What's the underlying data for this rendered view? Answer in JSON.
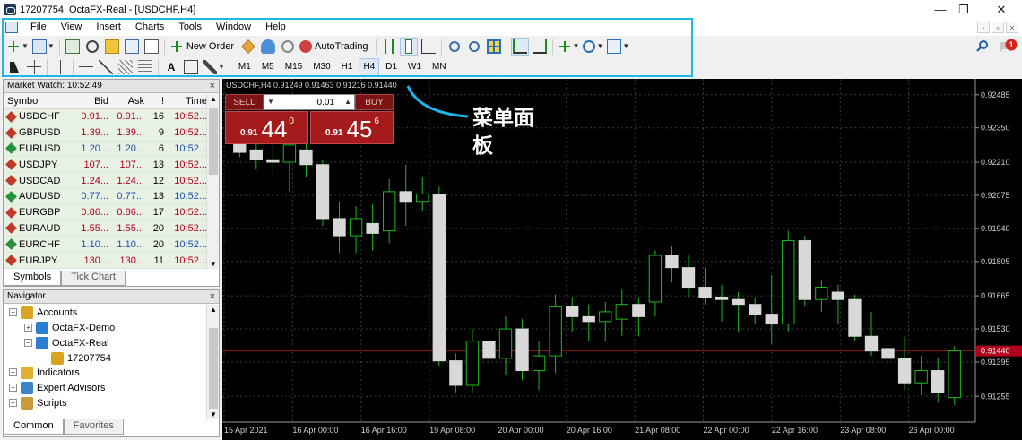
{
  "window": {
    "title": "17207754: OctaFX-Real - [USDCHF,H4]",
    "minimize_glyph": "—",
    "restore_glyph": "❐",
    "close_glyph": "✕"
  },
  "menu": {
    "items": [
      "File",
      "View",
      "Insert",
      "Charts",
      "Tools",
      "Window",
      "Help"
    ],
    "mdi_controls": [
      "-",
      "▫",
      "×"
    ]
  },
  "toolbar1": {
    "new_order_label": "New Order",
    "autotrading_label": "AutoTrading"
  },
  "toolbar2": {
    "text_tool_label": "A",
    "timeframes": [
      "M1",
      "M5",
      "M15",
      "M30",
      "H1",
      "H4",
      "D1",
      "W1",
      "MN"
    ],
    "active_timeframe": "H4"
  },
  "market_watch": {
    "title": "Market Watch: 10:52:49",
    "columns": [
      "Symbol",
      "Bid",
      "Ask",
      "!",
      "Time"
    ],
    "rows": [
      {
        "symbol": "USDCHF",
        "bid": "0.91...",
        "ask": "0.91...",
        "spread": "16",
        "time": "10:52...",
        "dir": "down"
      },
      {
        "symbol": "GBPUSD",
        "bid": "1.39...",
        "ask": "1.39...",
        "spread": "9",
        "time": "10:52...",
        "dir": "down"
      },
      {
        "symbol": "EURUSD",
        "bid": "1.20...",
        "ask": "1.20...",
        "spread": "6",
        "time": "10:52...",
        "dir": "up"
      },
      {
        "symbol": "USDJPY",
        "bid": "107...",
        "ask": "107...",
        "spread": "13",
        "time": "10:52...",
        "dir": "down"
      },
      {
        "symbol": "USDCAD",
        "bid": "1.24...",
        "ask": "1.24...",
        "spread": "12",
        "time": "10:52...",
        "dir": "down"
      },
      {
        "symbol": "AUDUSD",
        "bid": "0.77...",
        "ask": "0.77...",
        "spread": "13",
        "time": "10:52...",
        "dir": "up"
      },
      {
        "symbol": "EURGBP",
        "bid": "0.86...",
        "ask": "0.86...",
        "spread": "17",
        "time": "10:52...",
        "dir": "down"
      },
      {
        "symbol": "EURAUD",
        "bid": "1.55...",
        "ask": "1.55...",
        "spread": "20",
        "time": "10:52...",
        "dir": "down"
      },
      {
        "symbol": "EURCHF",
        "bid": "1.10...",
        "ask": "1.10...",
        "spread": "20",
        "time": "10:52...",
        "dir": "up"
      },
      {
        "symbol": "EURJPY",
        "bid": "130...",
        "ask": "130...",
        "spread": "11",
        "time": "10:52...",
        "dir": "down"
      }
    ],
    "tabs": [
      "Symbols",
      "Tick Chart"
    ],
    "active_tab": "Symbols"
  },
  "navigator": {
    "title": "Navigator",
    "items": [
      {
        "label": "Accounts",
        "level": 0,
        "toggle": "−",
        "icon": "accounts-icon"
      },
      {
        "label": "OctaFX-Demo",
        "level": 1,
        "toggle": "+",
        "icon": "server-icon"
      },
      {
        "label": "OctaFX-Real",
        "level": 1,
        "toggle": "−",
        "icon": "server-icon"
      },
      {
        "label": "17207754",
        "level": 2,
        "toggle": "",
        "icon": "account-user-icon"
      },
      {
        "label": "Indicators",
        "level": 0,
        "toggle": "+",
        "icon": "indicators-icon"
      },
      {
        "label": "Expert Advisors",
        "level": 0,
        "toggle": "+",
        "icon": "expert-advisors-icon"
      },
      {
        "label": "Scripts",
        "level": 0,
        "toggle": "+",
        "icon": "scripts-icon"
      }
    ],
    "tabs": [
      "Common",
      "Favorites"
    ],
    "active_tab": "Common"
  },
  "one_click": {
    "sell_label": "SELL",
    "buy_label": "BUY",
    "lot": "0.01",
    "sell_price_prefix": "0.91",
    "sell_price_big": "44",
    "sell_price_sup": "0",
    "buy_price_prefix": "0.91",
    "buy_price_big": "45",
    "buy_price_sup": "6"
  },
  "annotation": {
    "text": "菜单面板"
  },
  "chart_data": {
    "type": "candlestick",
    "caption": "USDCHF,H4  0.91249 0.91463 0.91216 0.91440",
    "ylim": [
      0.9115,
      0.9255
    ],
    "y_ticks": [
      0.92485,
      0.9235,
      0.9221,
      0.92075,
      0.9194,
      0.91805,
      0.91665,
      0.9153,
      0.91395,
      0.91255
    ],
    "y_tick_labels": [
      "0.92485",
      "0.92350",
      "0.92210",
      "0.92075",
      "0.91940",
      "0.91805",
      "0.91665",
      "0.91530",
      "0.91395",
      "0.91255"
    ],
    "current_price": 0.9144,
    "current_price_label": "0.91440",
    "x_labels": [
      "15 Apr 2021",
      "16 Apr 00:00",
      "16 Apr 16:00",
      "19 Apr 08:00",
      "20 Apr 00:00",
      "20 Apr 16:00",
      "21 Apr 08:00",
      "22 Apr 00:00",
      "22 Apr 16:00",
      "23 Apr 08:00",
      "26 Apr 00:00"
    ],
    "candles": [
      {
        "o": 0.9232,
        "h": 0.9242,
        "l": 0.9223,
        "c": 0.9225
      },
      {
        "o": 0.9226,
        "h": 0.9236,
        "l": 0.9218,
        "c": 0.9222
      },
      {
        "o": 0.9222,
        "h": 0.9233,
        "l": 0.9216,
        "c": 0.9221
      },
      {
        "o": 0.9221,
        "h": 0.923,
        "l": 0.9209,
        "c": 0.9228
      },
      {
        "o": 0.9226,
        "h": 0.9235,
        "l": 0.9215,
        "c": 0.922
      },
      {
        "o": 0.922,
        "h": 0.9222,
        "l": 0.9195,
        "c": 0.9198
      },
      {
        "o": 0.9198,
        "h": 0.9205,
        "l": 0.9184,
        "c": 0.9191
      },
      {
        "o": 0.9191,
        "h": 0.9203,
        "l": 0.9184,
        "c": 0.9198
      },
      {
        "o": 0.9196,
        "h": 0.9204,
        "l": 0.9185,
        "c": 0.9192
      },
      {
        "o": 0.9193,
        "h": 0.9214,
        "l": 0.9188,
        "c": 0.9209
      },
      {
        "o": 0.9209,
        "h": 0.922,
        "l": 0.9195,
        "c": 0.9205
      },
      {
        "o": 0.9205,
        "h": 0.9215,
        "l": 0.9201,
        "c": 0.9208
      },
      {
        "o": 0.9208,
        "h": 0.9211,
        "l": 0.9138,
        "c": 0.914
      },
      {
        "o": 0.914,
        "h": 0.9143,
        "l": 0.9127,
        "c": 0.913
      },
      {
        "o": 0.913,
        "h": 0.9153,
        "l": 0.9127,
        "c": 0.9148
      },
      {
        "o": 0.9148,
        "h": 0.9152,
        "l": 0.9137,
        "c": 0.9141
      },
      {
        "o": 0.9141,
        "h": 0.9158,
        "l": 0.9134,
        "c": 0.9153
      },
      {
        "o": 0.9153,
        "h": 0.9157,
        "l": 0.9132,
        "c": 0.9136
      },
      {
        "o": 0.9136,
        "h": 0.9148,
        "l": 0.9128,
        "c": 0.9142
      },
      {
        "o": 0.9142,
        "h": 0.9167,
        "l": 0.9135,
        "c": 0.9162
      },
      {
        "o": 0.9162,
        "h": 0.9166,
        "l": 0.9152,
        "c": 0.9158
      },
      {
        "o": 0.9158,
        "h": 0.9163,
        "l": 0.9148,
        "c": 0.9156
      },
      {
        "o": 0.9156,
        "h": 0.9164,
        "l": 0.9148,
        "c": 0.916
      },
      {
        "o": 0.9157,
        "h": 0.9169,
        "l": 0.915,
        "c": 0.9163
      },
      {
        "o": 0.9163,
        "h": 0.9166,
        "l": 0.915,
        "c": 0.9158
      },
      {
        "o": 0.9164,
        "h": 0.9185,
        "l": 0.9158,
        "c": 0.9183
      },
      {
        "o": 0.9183,
        "h": 0.9187,
        "l": 0.9172,
        "c": 0.9178
      },
      {
        "o": 0.9178,
        "h": 0.9183,
        "l": 0.9166,
        "c": 0.917
      },
      {
        "o": 0.917,
        "h": 0.9178,
        "l": 0.9163,
        "c": 0.9166
      },
      {
        "o": 0.9166,
        "h": 0.9171,
        "l": 0.9156,
        "c": 0.9165
      },
      {
        "o": 0.9165,
        "h": 0.9168,
        "l": 0.9152,
        "c": 0.9163
      },
      {
        "o": 0.9163,
        "h": 0.9166,
        "l": 0.9155,
        "c": 0.9159
      },
      {
        "o": 0.9159,
        "h": 0.9175,
        "l": 0.9147,
        "c": 0.9155
      },
      {
        "o": 0.9155,
        "h": 0.9193,
        "l": 0.9152,
        "c": 0.9189
      },
      {
        "o": 0.9189,
        "h": 0.9191,
        "l": 0.9162,
        "c": 0.9165
      },
      {
        "o": 0.9165,
        "h": 0.9173,
        "l": 0.916,
        "c": 0.917
      },
      {
        "o": 0.9168,
        "h": 0.9171,
        "l": 0.9155,
        "c": 0.9165
      },
      {
        "o": 0.9165,
        "h": 0.9167,
        "l": 0.9148,
        "c": 0.915
      },
      {
        "o": 0.915,
        "h": 0.916,
        "l": 0.9142,
        "c": 0.9144
      },
      {
        "o": 0.9145,
        "h": 0.9158,
        "l": 0.9138,
        "c": 0.9141
      },
      {
        "o": 0.9141,
        "h": 0.915,
        "l": 0.9128,
        "c": 0.9131
      },
      {
        "o": 0.9131,
        "h": 0.9142,
        "l": 0.9126,
        "c": 0.9136
      },
      {
        "o": 0.9136,
        "h": 0.9141,
        "l": 0.9123,
        "c": 0.9127
      },
      {
        "o": 0.9125,
        "h": 0.9146,
        "l": 0.9122,
        "c": 0.9144
      }
    ]
  }
}
